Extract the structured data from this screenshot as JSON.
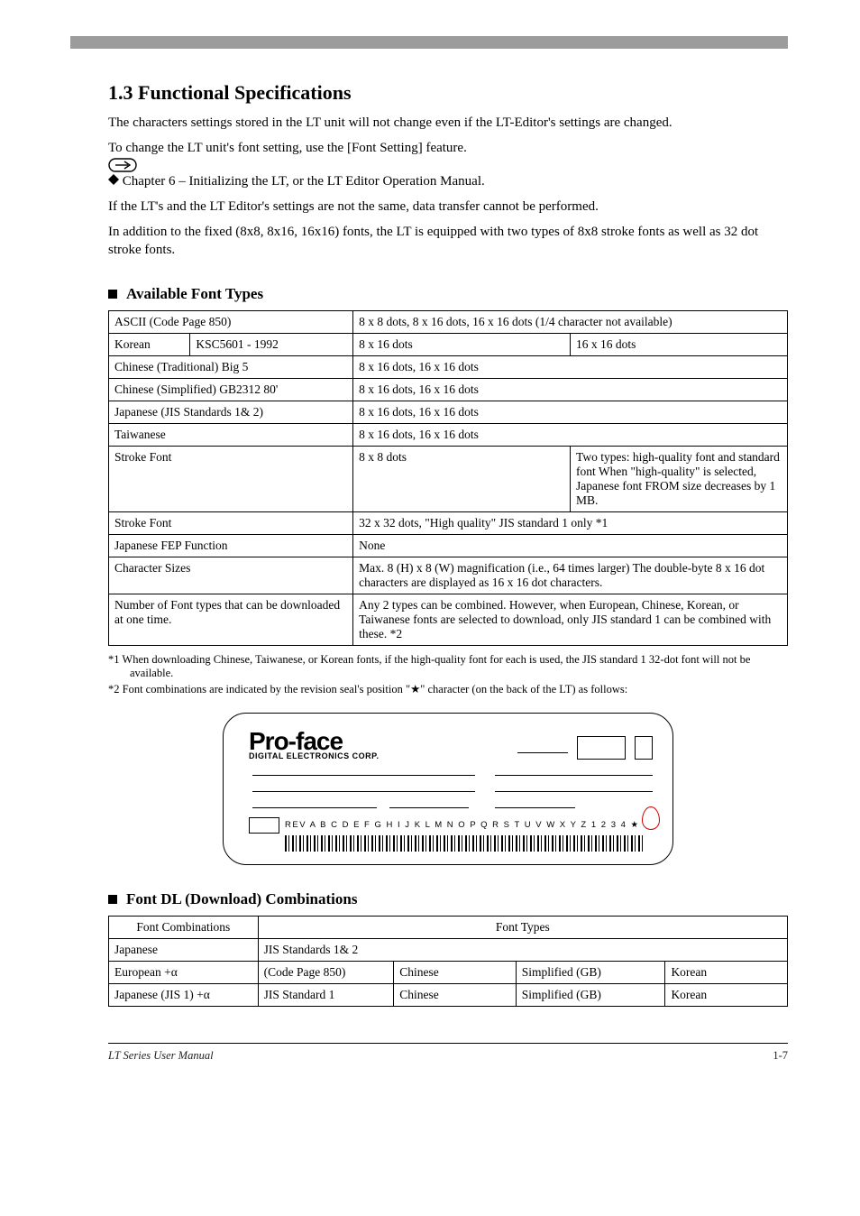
{
  "header": {
    "section_num": "1.3",
    "section_title": "Functional Specifications"
  },
  "intro": {
    "p1": "The characters settings stored in the LT unit will not change even if the LT-Editor's settings are changed.",
    "p2_pre": "To change the LT unit's font setting, use the [Font Setting] feature.",
    "p2_ref": " Chapter 6 – Initializing the LT, or the LT Editor Operation Manual.",
    "p3": "If the LT's and the LT Editor's settings are not the same, data transfer cannot be performed.",
    "p4": "In addition to the fixed (8x8, 8x16, 16x16) fonts, the LT is equipped with two types of 8x8 stroke fonts as well as 32 dot stroke fonts."
  },
  "availableFonts": {
    "title": "Available Font Types",
    "table": {
      "rows": [
        {
          "c1": "ASCII (Code Page 850)",
          "c2": "8 x 8 dots, 8 x 16 dots, 16 x 16 dots (1/4 character not available)"
        },
        {
          "c1a": "Korean",
          "c1b": "KSC5601 - 1992",
          "c2a": "8 x 16 dots",
          "c2b": "16 x 16 dots"
        },
        {
          "c1": "Chinese (Traditional) Big 5",
          "c2": "8 x 16 dots, 16 x 16 dots"
        },
        {
          "c1": "Chinese (Simplified) GB2312 80'",
          "c2": "8 x 16 dots, 16 x 16 dots"
        },
        {
          "c1": "Japanese (JIS Standards 1& 2)",
          "c2": "8 x 16 dots, 16 x 16 dots"
        },
        {
          "c1": "Taiwanese",
          "c2": "8 x 16 dots, 16 x 16 dots"
        },
        {
          "c1": "Stroke Font",
          "c2a": "8 x 8 dots",
          "c2b": "Two types: high-quality font and standard font When \"high-quality\" is selected, Japanese font FROM size decreases by 1 MB."
        },
        {
          "c1": "Stroke Font",
          "c2": "32 x 32 dots, \"High quality\" JIS standard 1 only *1"
        },
        {
          "c1": "Japanese FEP Function",
          "c2": "None"
        },
        {
          "c1": "Character Sizes",
          "c2": "Max. 8 (H) x 8 (W) magnification (i.e., 64 times larger) The double-byte 8 x 16 dot characters are displayed as 16 x 16 dot characters."
        },
        {
          "c1": "Number of Font types that can be downloaded at one time.",
          "c2": "Any 2 types can be combined. However, when European, Chinese, Korean, or Taiwanese fonts are selected to download, only JIS standard 1 can be combined with these. *2"
        }
      ]
    },
    "fn1": "*1 When downloading Chinese, Taiwanese, or Korean fonts, if the high-quality font for each is used, the JIS standard 1 32-dot font will not be available.",
    "fn2": "*2 Font combinations are indicated by the revision seal's position \"★\" character (on the back of the LT) as follows:"
  },
  "nameplate": {
    "brand_big": "Pro-face",
    "brand_small": "DIGITAL ELECTRONICS CORP.",
    "rev_letters": "REV  A B C D E F G H I J K L M N O P Q R S T U V W X Y Z 1 2 3 4 ★"
  },
  "fontDLCombinations": {
    "title": "Font DL (Download) Combinations",
    "rows": [
      [
        "Font Combinations",
        "Font Types"
      ],
      [
        "Japanese",
        "JIS Standards 1& 2"
      ],
      [
        "European +α",
        "(Code Page 850)",
        "Chinese",
        "Simplified (GB)",
        "Korean"
      ],
      [
        "Japanese (JIS 1) +α",
        "JIS Standard 1",
        "Chinese",
        "Simplified (GB)",
        "Korean"
      ]
    ]
  },
  "footer": {
    "left": "LT Series User Manual",
    "page": "1-7"
  }
}
